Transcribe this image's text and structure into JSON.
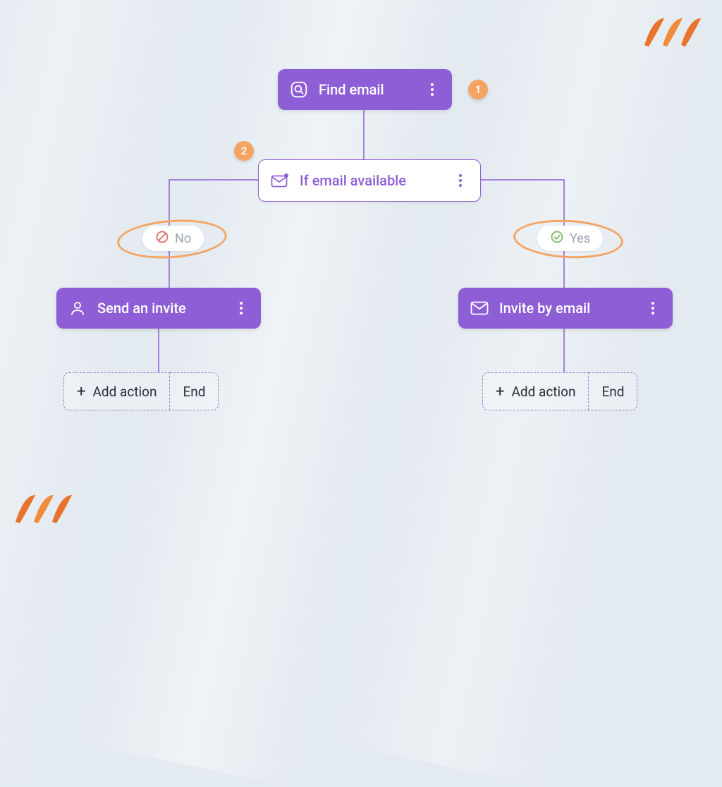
{
  "nodes": {
    "find_email": {
      "label": "Find email"
    },
    "if_email": {
      "label": "If email available"
    },
    "send_invite": {
      "label": "Send an invite"
    },
    "invite_by_email": {
      "label": "Invite by email"
    }
  },
  "branches": {
    "no": "No",
    "yes": "Yes"
  },
  "footer_left": {
    "add": "Add action",
    "end": "End"
  },
  "footer_right": {
    "add": "Add action",
    "end": "End"
  },
  "steps": {
    "one": "1",
    "two": "2"
  },
  "colors": {
    "purple": "#8e5ed6",
    "orange": "#f4a462",
    "bg": "#e3eaf0"
  }
}
